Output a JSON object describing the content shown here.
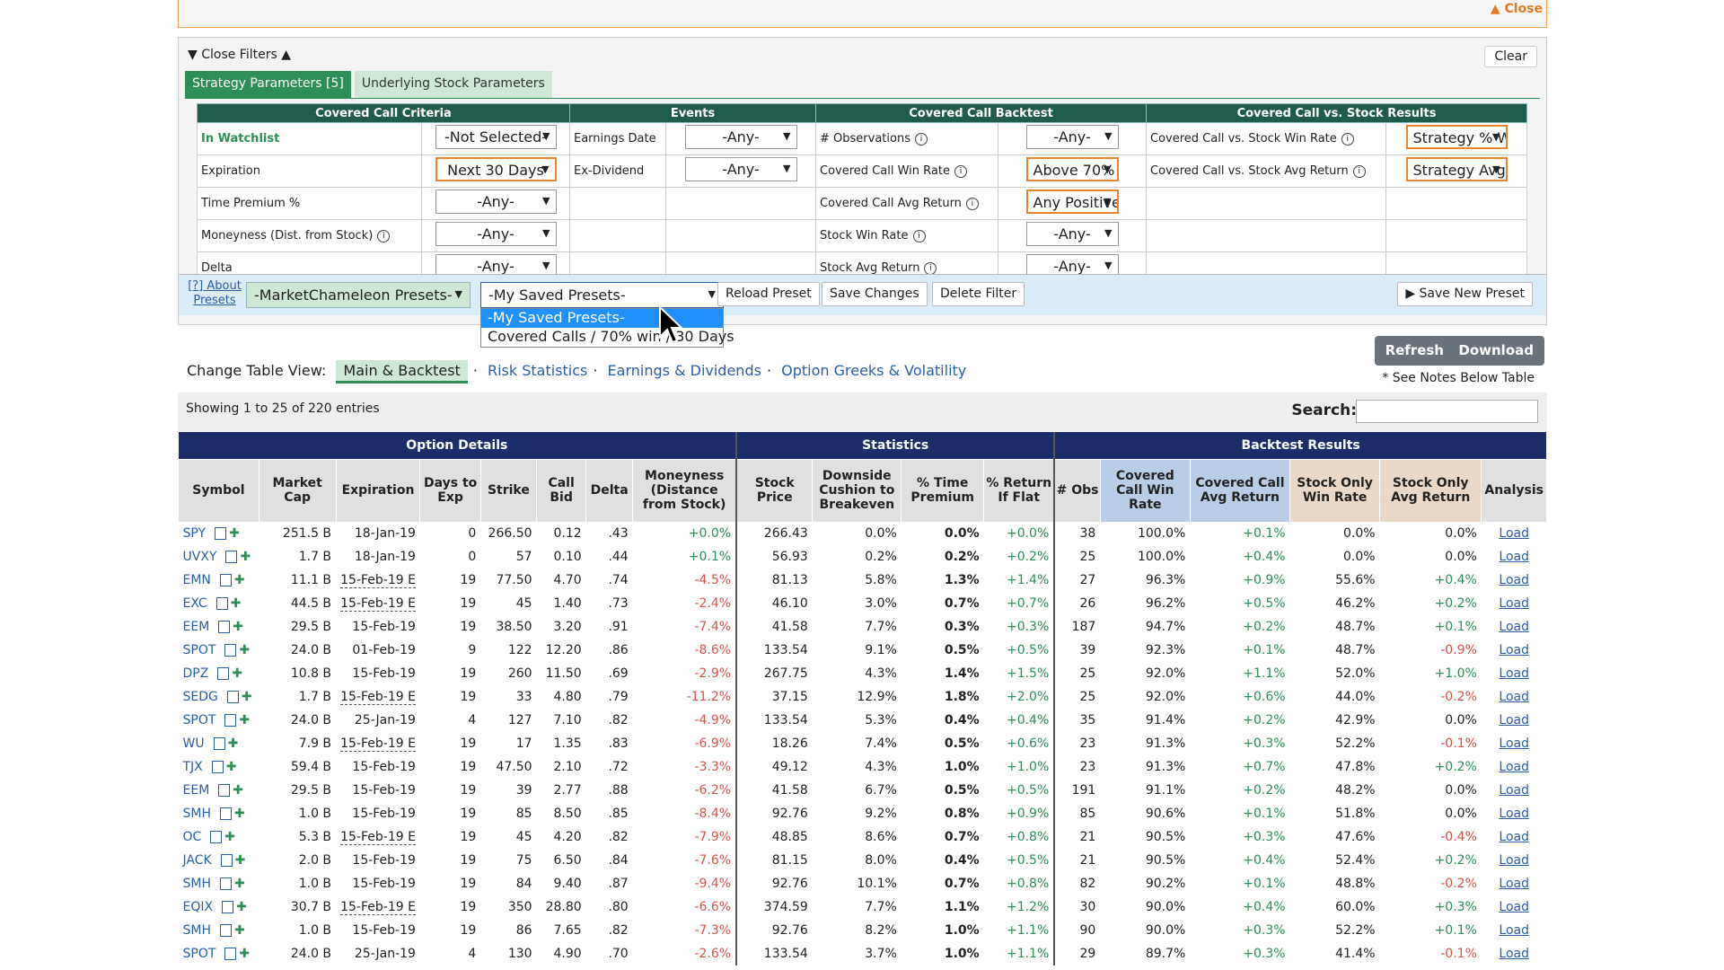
{
  "topbar": {
    "close": "▲ Close"
  },
  "filters": {
    "close_filters": "Close Filters ▲",
    "clear": "Clear",
    "tabs": [
      "Strategy Parameters  [5]",
      "Underlying Stock Parameters"
    ],
    "headers": [
      "Covered Call Criteria",
      "Events",
      "Covered Call Backtest",
      "Covered Call vs. Stock Results"
    ],
    "rows": [
      {
        "l1": "In Watchlist",
        "v1": "-Not Selected-",
        "l2": "Earnings Date",
        "v2": "-Any-",
        "l3": "# Observations",
        "v3": "-Any-",
        "l4": "Covered Call vs. Stock Win Rate",
        "v4": "Strategy % W"
      },
      {
        "l1": "Expiration",
        "v1": "Next 30 Days",
        "l2": "Ex-Dividend",
        "v2": "-Any-",
        "l3": "Covered Call Win Rate",
        "v3": "Above 70%",
        "l4": "Covered Call vs. Stock Avg Return",
        "v4": "Strategy Avg I"
      },
      {
        "l1": "Time Premium %",
        "v1": "-Any-",
        "l2": "",
        "v2": "",
        "l3": "Covered Call Avg Return",
        "v3": "Any Positive",
        "l4": "",
        "v4": ""
      },
      {
        "l1": "Moneyness (Dist. from Stock)",
        "v1": "-Any-",
        "l2": "",
        "v2": "",
        "l3": "Stock Win Rate",
        "v3": "-Any-",
        "l4": "",
        "v4": ""
      },
      {
        "l1": "Delta",
        "v1": "-Any-",
        "l2": "",
        "v2": "",
        "l3": "Stock Avg Return",
        "v3": "-Any-",
        "l4": "",
        "v4": ""
      }
    ]
  },
  "presets": {
    "about": "[?] About Presets",
    "mc": "-MarketChameleon Presets-",
    "mine": "-My Saved Presets-",
    "reload": "Reload Preset",
    "save": "Save Changes",
    "delete": "Delete Filter",
    "new": "▶ Save New Preset",
    "options": [
      "-My Saved Presets-",
      "Covered Calls / 70% win / 30 Days"
    ]
  },
  "view": {
    "label": "Change Table View:",
    "tabs": [
      "Main & Backtest",
      "Risk Statistics",
      "Earnings & Dividends",
      "Option Greeks & Volatility"
    ]
  },
  "actions": {
    "refresh": "Refresh",
    "download": "Download",
    "notes": "* See Notes Below Table"
  },
  "table": {
    "showing": "Showing 1 to 25 of 220 entries",
    "search": "Search:",
    "groups": [
      "Option Details",
      "Statistics",
      "Backtest Results"
    ],
    "cols": [
      "Symbol",
      "Market Cap",
      "Expiration",
      "Days to Exp",
      "Strike",
      "Call Bid",
      "Delta",
      "Moneyness (Distance from Stock)",
      "Stock Price",
      "Downside Cushion to Breakeven",
      "% Time Premium",
      "% Return If Flat",
      "# Obs",
      "Covered Call Win Rate",
      "Covered Call Avg Return",
      "Stock Only Win Rate",
      "Stock Only Avg Return",
      "Analysis"
    ],
    "rows": [
      [
        "SPY",
        "251.5 B",
        "18-Jan-19",
        "0",
        "266.50",
        "0.12",
        ".43",
        "+0.0%",
        "266.43",
        "0.0%",
        "0.0%",
        "+0.0%",
        "38",
        "100.0%",
        "+0.1%",
        "0.0%",
        "0.0%"
      ],
      [
        "UVXY",
        "1.7 B",
        "18-Jan-19",
        "0",
        "57",
        "0.10",
        ".44",
        "+0.1%",
        "56.93",
        "0.2%",
        "0.2%",
        "+0.2%",
        "25",
        "100.0%",
        "+0.4%",
        "0.0%",
        "0.0%"
      ],
      [
        "EMN",
        "11.1 B",
        "15-Feb-19 E",
        "19",
        "77.50",
        "4.70",
        ".74",
        "-4.5%",
        "81.13",
        "5.8%",
        "1.3%",
        "+1.4%",
        "27",
        "96.3%",
        "+0.9%",
        "55.6%",
        "+0.4%"
      ],
      [
        "EXC",
        "44.5 B",
        "15-Feb-19 E",
        "19",
        "45",
        "1.40",
        ".73",
        "-2.4%",
        "46.10",
        "3.0%",
        "0.7%",
        "+0.7%",
        "26",
        "96.2%",
        "+0.5%",
        "46.2%",
        "+0.2%"
      ],
      [
        "EEM",
        "29.5 B",
        "15-Feb-19",
        "19",
        "38.50",
        "3.20",
        ".91",
        "-7.4%",
        "41.58",
        "7.7%",
        "0.3%",
        "+0.3%",
        "187",
        "94.7%",
        "+0.2%",
        "48.7%",
        "+0.1%"
      ],
      [
        "SPOT",
        "24.0 B",
        "01-Feb-19",
        "9",
        "122",
        "12.20",
        ".86",
        "-8.6%",
        "133.54",
        "9.1%",
        "0.5%",
        "+0.5%",
        "39",
        "92.3%",
        "+0.1%",
        "48.7%",
        "-0.9%"
      ],
      [
        "DPZ",
        "10.8 B",
        "15-Feb-19",
        "19",
        "260",
        "11.50",
        ".69",
        "-2.9%",
        "267.75",
        "4.3%",
        "1.4%",
        "+1.5%",
        "25",
        "92.0%",
        "+1.1%",
        "52.0%",
        "+1.0%"
      ],
      [
        "SEDG",
        "1.7 B",
        "15-Feb-19 E",
        "19",
        "33",
        "4.80",
        ".79",
        "-11.2%",
        "37.15",
        "12.9%",
        "1.8%",
        "+2.0%",
        "25",
        "92.0%",
        "+0.6%",
        "44.0%",
        "-0.2%"
      ],
      [
        "SPOT",
        "24.0 B",
        "25-Jan-19",
        "4",
        "127",
        "7.10",
        ".82",
        "-4.9%",
        "133.54",
        "5.3%",
        "0.4%",
        "+0.4%",
        "35",
        "91.4%",
        "+0.2%",
        "42.9%",
        "0.0%"
      ],
      [
        "WU",
        "7.9 B",
        "15-Feb-19 E",
        "19",
        "17",
        "1.35",
        ".83",
        "-6.9%",
        "18.26",
        "7.4%",
        "0.5%",
        "+0.6%",
        "23",
        "91.3%",
        "+0.3%",
        "52.2%",
        "-0.1%"
      ],
      [
        "TJX",
        "59.4 B",
        "15-Feb-19",
        "19",
        "47.50",
        "2.10",
        ".72",
        "-3.3%",
        "49.12",
        "4.3%",
        "1.0%",
        "+1.0%",
        "23",
        "91.3%",
        "+0.7%",
        "47.8%",
        "+0.2%"
      ],
      [
        "EEM",
        "29.5 B",
        "15-Feb-19",
        "19",
        "39",
        "2.77",
        ".88",
        "-6.2%",
        "41.58",
        "6.7%",
        "0.5%",
        "+0.5%",
        "191",
        "91.1%",
        "+0.2%",
        "48.2%",
        "0.0%"
      ],
      [
        "SMH",
        "1.0 B",
        "15-Feb-19",
        "19",
        "85",
        "8.50",
        ".85",
        "-8.4%",
        "92.76",
        "9.2%",
        "0.8%",
        "+0.9%",
        "85",
        "90.6%",
        "+0.1%",
        "51.8%",
        "0.0%"
      ],
      [
        "OC",
        "5.3 B",
        "15-Feb-19 E",
        "19",
        "45",
        "4.20",
        ".82",
        "-7.9%",
        "48.85",
        "8.6%",
        "0.7%",
        "+0.8%",
        "21",
        "90.5%",
        "+0.3%",
        "47.6%",
        "-0.4%"
      ],
      [
        "JACK",
        "2.0 B",
        "15-Feb-19",
        "19",
        "75",
        "6.50",
        ".84",
        "-7.6%",
        "81.15",
        "8.0%",
        "0.4%",
        "+0.5%",
        "21",
        "90.5%",
        "+0.4%",
        "52.4%",
        "+0.2%"
      ],
      [
        "SMH",
        "1.0 B",
        "15-Feb-19",
        "19",
        "84",
        "9.40",
        ".87",
        "-9.4%",
        "92.76",
        "10.1%",
        "0.7%",
        "+0.8%",
        "82",
        "90.2%",
        "+0.1%",
        "48.8%",
        "-0.2%"
      ],
      [
        "EQIX",
        "30.7 B",
        "15-Feb-19 E",
        "19",
        "350",
        "28.80",
        ".80",
        "-6.6%",
        "374.59",
        "7.7%",
        "1.1%",
        "+1.2%",
        "30",
        "90.0%",
        "+0.4%",
        "60.0%",
        "+0.3%"
      ],
      [
        "SMH",
        "1.0 B",
        "15-Feb-19",
        "19",
        "86",
        "7.65",
        ".82",
        "-7.3%",
        "92.76",
        "8.2%",
        "1.0%",
        "+1.1%",
        "90",
        "90.0%",
        "+0.3%",
        "52.2%",
        "+0.1%"
      ],
      [
        "SPOT",
        "24.0 B",
        "25-Jan-19",
        "4",
        "130",
        "4.90",
        ".70",
        "-2.6%",
        "133.54",
        "3.7%",
        "1.0%",
        "+1.1%",
        "29",
        "89.7%",
        "+0.3%",
        "41.4%",
        "-0.1%"
      ]
    ],
    "load": "Load"
  }
}
